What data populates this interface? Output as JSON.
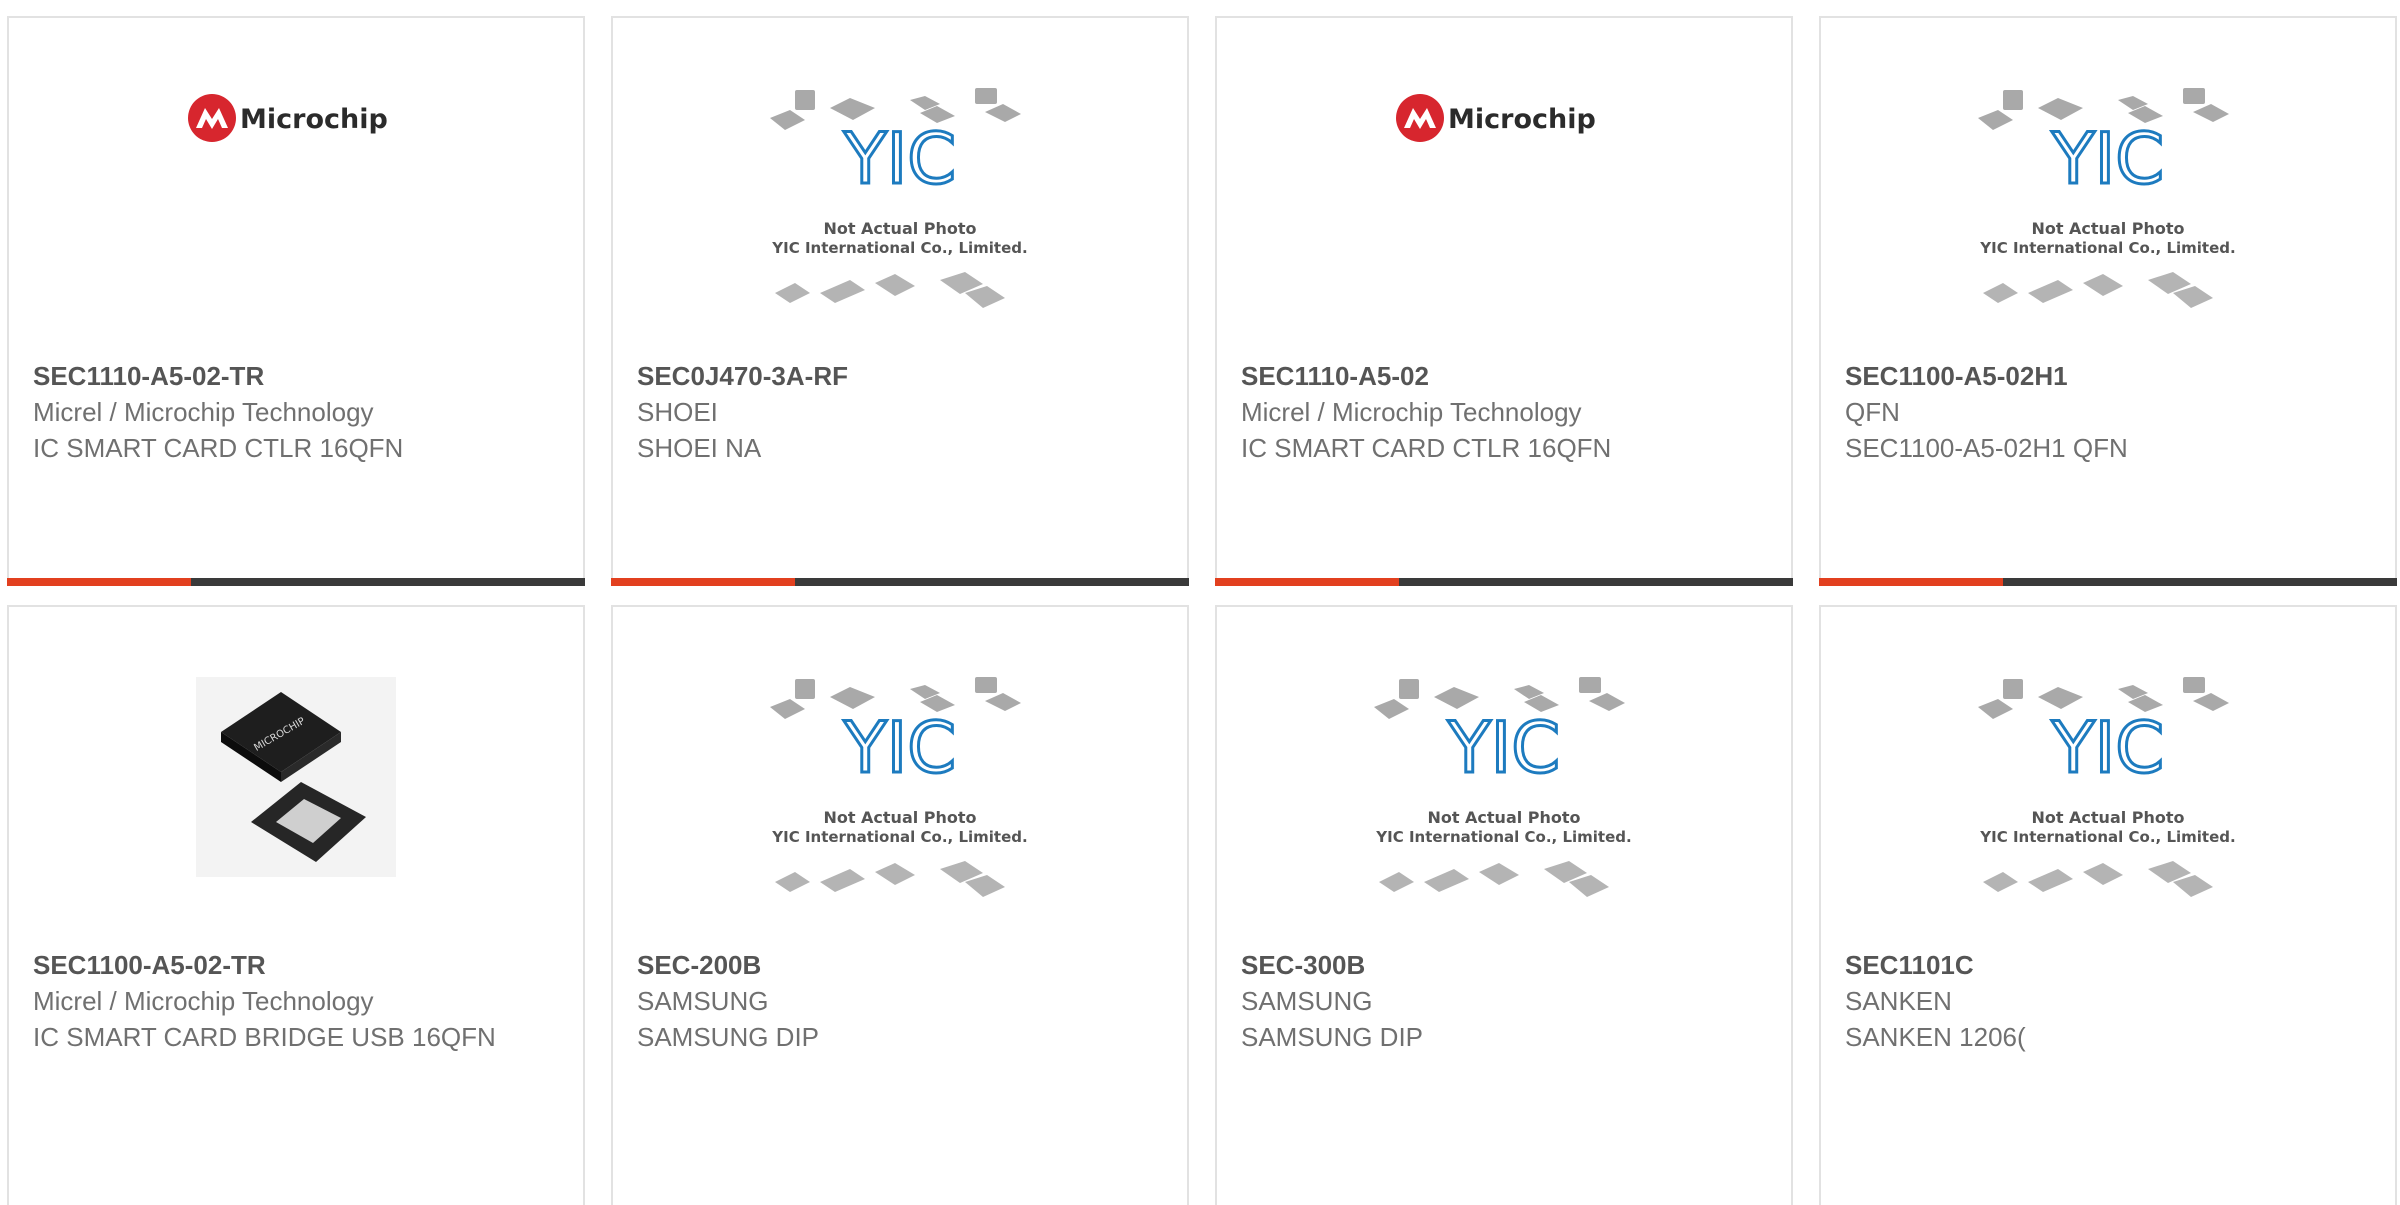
{
  "colors": {
    "accent": "#e2401f",
    "bar": "#3a3a3a",
    "title": "#555555",
    "text": "#707070"
  },
  "placeholder": {
    "line1": "Not Actual Photo",
    "line2": "YIC International Co., Limited."
  },
  "brand": {
    "name": "Microchip"
  },
  "products": [
    {
      "part": "SEC1110-A5-02-TR",
      "maker": "Micrel / Microchip Technology",
      "desc": "IC SMART CARD CTLR 16QFN",
      "image": "microchip-logo"
    },
    {
      "part": "SEC0J470-3A-RF",
      "maker": "SHOEI",
      "desc": "SHOEI NA",
      "image": "yic-placeholder"
    },
    {
      "part": "SEC1110-A5-02",
      "maker": "Micrel / Microchip Technology",
      "desc": "IC SMART CARD CTLR 16QFN",
      "image": "microchip-logo"
    },
    {
      "part": "SEC1100-A5-02H1",
      "maker": "QFN",
      "desc": "SEC1100-A5-02H1 QFN",
      "image": "yic-placeholder"
    },
    {
      "part": "SEC1100-A5-02-TR",
      "maker": "Micrel / Microchip Technology",
      "desc": "IC SMART CARD BRIDGE USB 16QFN",
      "image": "qfn-chip-photo"
    },
    {
      "part": "SEC-200B",
      "maker": "SAMSUNG",
      "desc": "SAMSUNG DIP",
      "image": "yic-placeholder"
    },
    {
      "part": "SEC-300B",
      "maker": "SAMSUNG",
      "desc": "SAMSUNG DIP",
      "image": "yic-placeholder"
    },
    {
      "part": "SEC1101C",
      "maker": "SANKEN",
      "desc": "SANKEN 1206(",
      "image": "yic-placeholder"
    }
  ]
}
